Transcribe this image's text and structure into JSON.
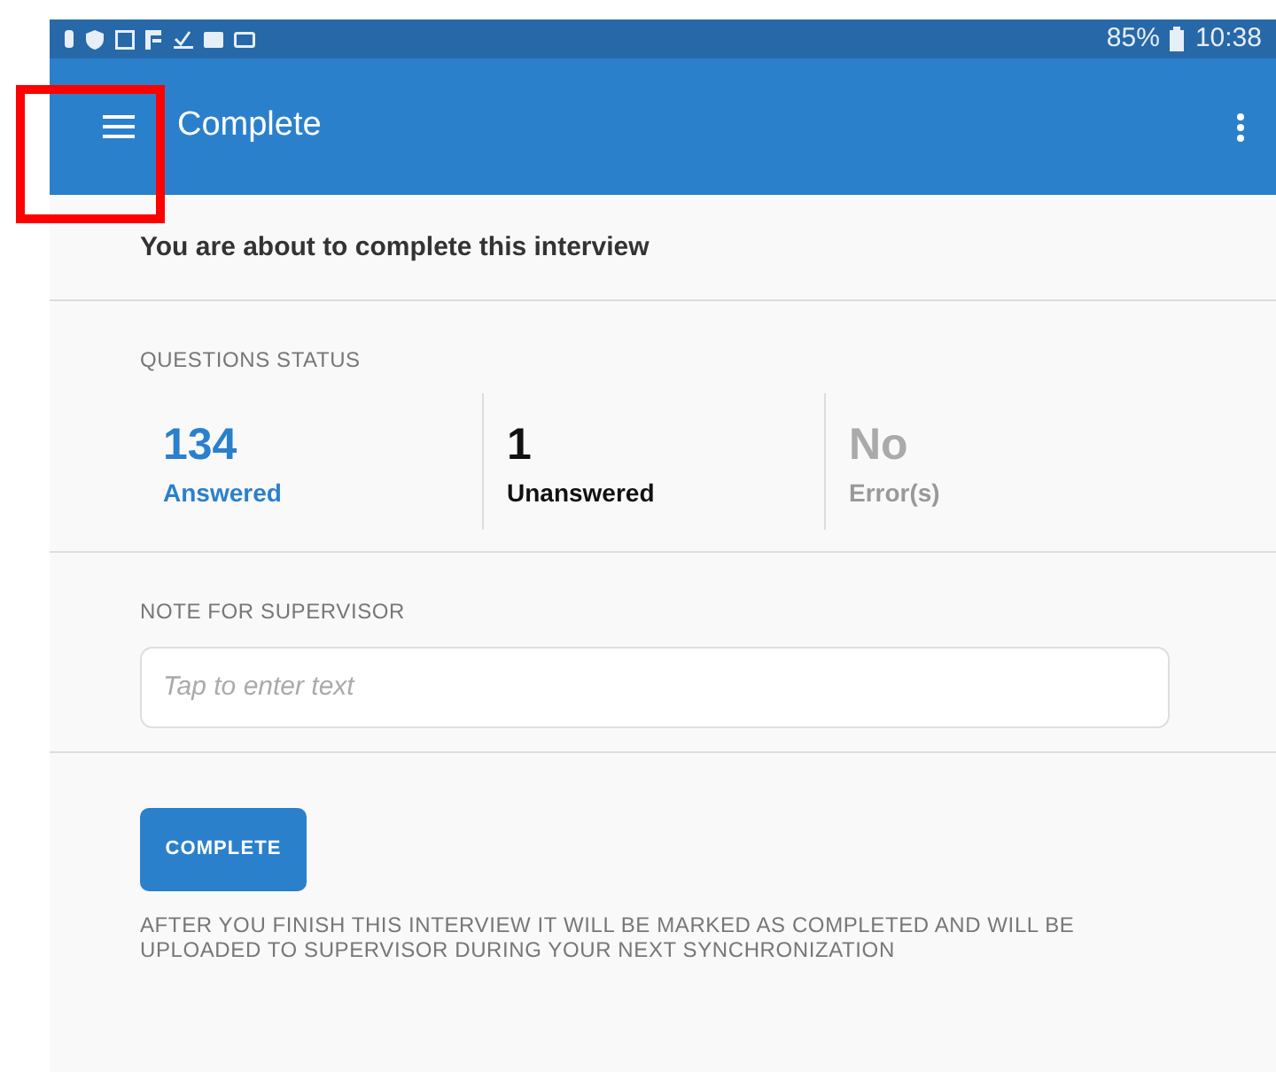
{
  "status_bar": {
    "battery": "85%",
    "time": "10:38"
  },
  "app_bar": {
    "title": "Complete"
  },
  "intro": "You are about to complete this interview",
  "questions_status": {
    "label": "QUESTIONS STATUS",
    "stats": [
      {
        "kind": "answered",
        "value": "134",
        "label": "Answered"
      },
      {
        "kind": "unanswered",
        "value": "1",
        "label": "Unanswered"
      },
      {
        "kind": "errors",
        "value": "No",
        "label": "Error(s)"
      }
    ]
  },
  "note": {
    "label": "NOTE FOR SUPERVISOR",
    "placeholder": "Tap to enter text"
  },
  "complete_button": "COMPLETE",
  "footer_note": "AFTER YOU FINISH THIS INTERVIEW IT WILL BE MARKED AS COMPLETED AND WILL BE UPLOADED TO SUPERVISOR DURING YOUR NEXT SYNCHRONIZATION"
}
